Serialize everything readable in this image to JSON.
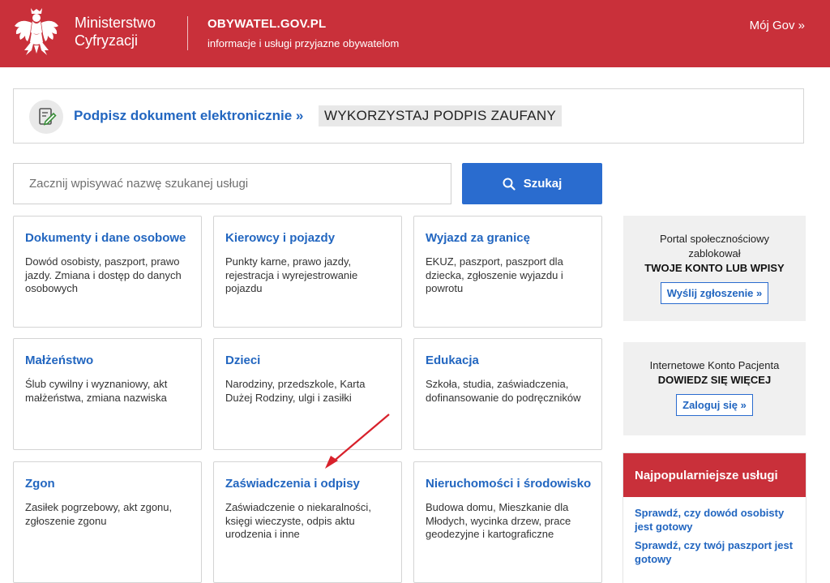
{
  "header": {
    "ministry_line1": "Ministerstwo",
    "ministry_line2": "Cyfryzacji",
    "site_name": "OBYWATEL.GOV.PL",
    "site_tagline": "informacje i usługi przyjazne obywatelom",
    "account_link": "Mój Gov »"
  },
  "sign_banner": {
    "link": "Podpisz dokument elektronicznie »",
    "badge": "WYKORZYSTAJ PODPIS ZAUFANY"
  },
  "search": {
    "placeholder": "Zacznij wpisywać nazwę szukanej usługi",
    "value": "",
    "button_label": "Szukaj"
  },
  "categories": [
    {
      "title": "Dokumenty i dane osobowe",
      "desc": "Dowód osobisty, paszport, prawo jazdy. Zmiana i dostęp do danych osobowych"
    },
    {
      "title": "Kierowcy i pojazdy",
      "desc": "Punkty karne, prawo jazdy, rejestracja i wyrejestrowanie pojazdu"
    },
    {
      "title": "Wyjazd za granicę",
      "desc": "EKUZ, paszport, paszport dla dziecka, zgłoszenie wyjazdu i powrotu"
    },
    {
      "title": "Małżeństwo",
      "desc": "Ślub cywilny i wyznaniowy, akt małżeństwa, zmiana nazwiska"
    },
    {
      "title": "Dzieci",
      "desc": "Narodziny, przedszkole, Karta Dużej Rodziny, ulgi i zasiłki"
    },
    {
      "title": "Edukacja",
      "desc": "Szkoła, studia, zaświadczenia, dofinansowanie do podręczników"
    },
    {
      "title": "Zgon",
      "desc": "Zasiłek pogrzebowy, akt zgonu, zgłoszenie zgonu"
    },
    {
      "title": "Zaświadczenia i odpisy",
      "desc": "Zaświadczenie o niekaralności, księgi wieczyste, odpis aktu urodzenia i inne"
    },
    {
      "title": "Nieruchomości i środowisko",
      "desc": "Budowa domu, Mieszkanie dla Młodych, wycinka drzew, prace geodezyjne i kartograficzne"
    }
  ],
  "sidebar": {
    "box1": {
      "line1": "Portal społecznościowy",
      "line2": "zablokował",
      "strong": "TWOJE KONTO LUB WPISY",
      "button": "Wyślij zgłoszenie »"
    },
    "box2": {
      "line1": "Internetowe Konto Pacjenta",
      "strong": "DOWIEDZ SIĘ WIĘCEJ",
      "button": "Zaloguj się »"
    },
    "popular": {
      "title": "Najpopularniejsze usługi",
      "links": [
        "Sprawdź, czy dowód osobisty jest gotowy",
        "Sprawdź, czy twój paszport jest gotowy"
      ]
    }
  },
  "colors": {
    "brand_red": "#c9303a",
    "link_blue": "#2266c0",
    "button_blue": "#2a6ccf",
    "annotation_arrow": "#d8212b"
  },
  "icons": [
    "polish-eagle-emblem",
    "sign-document-icon",
    "search-icon"
  ]
}
